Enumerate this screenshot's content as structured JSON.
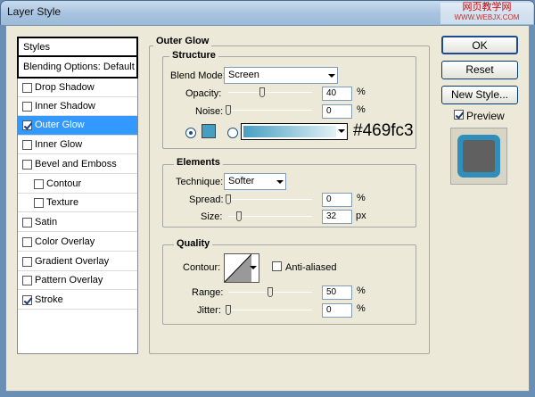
{
  "window": {
    "title": "Layer Style",
    "watermark_line1": "网页教学网",
    "watermark_line2": "WWW.WEBJX.COM"
  },
  "sidebar": {
    "header": "Styles",
    "blending": "Blending Options: Default",
    "items": [
      {
        "label": "Drop Shadow",
        "checked": false
      },
      {
        "label": "Inner Shadow",
        "checked": false
      },
      {
        "label": "Outer Glow",
        "checked": true
      },
      {
        "label": "Inner Glow",
        "checked": false
      },
      {
        "label": "Bevel and Emboss",
        "checked": false
      },
      {
        "label": "Contour",
        "checked": false
      },
      {
        "label": "Texture",
        "checked": false
      },
      {
        "label": "Satin",
        "checked": false
      },
      {
        "label": "Color Overlay",
        "checked": false
      },
      {
        "label": "Gradient Overlay",
        "checked": false
      },
      {
        "label": "Pattern Overlay",
        "checked": false
      },
      {
        "label": "Stroke",
        "checked": true
      }
    ]
  },
  "main": {
    "section_title": "Outer Glow",
    "structure": {
      "title": "Structure",
      "blend_mode_label": "Blend Mode:",
      "blend_mode": "Screen",
      "opacity_label": "Opacity:",
      "opacity": "40",
      "noise_label": "Noise:",
      "noise": "0",
      "percent": "%",
      "color_hex": "#469fc3",
      "color_swatch": "#469fc3"
    },
    "elements": {
      "title": "Elements",
      "technique_label": "Technique:",
      "technique": "Softer",
      "spread_label": "Spread:",
      "spread": "0",
      "size_label": "Size:",
      "size": "32",
      "percent": "%",
      "px": "px"
    },
    "quality": {
      "title": "Quality",
      "contour_label": "Contour:",
      "anti_aliased": "Anti-aliased",
      "range_label": "Range:",
      "range": "50",
      "jitter_label": "Jitter:",
      "jitter": "0",
      "percent": "%"
    }
  },
  "buttons": {
    "ok": "OK",
    "reset": "Reset",
    "new_style": "New Style...",
    "preview": "Preview"
  },
  "sliders": {
    "opacity": 0.4,
    "noise": 0,
    "spread": 0,
    "size": 0.13,
    "range": 0.5,
    "jitter": 0
  },
  "colors": {
    "accent": "#3399ff",
    "preview_outer": "#2f8fba",
    "preview_inner": "#606060"
  }
}
